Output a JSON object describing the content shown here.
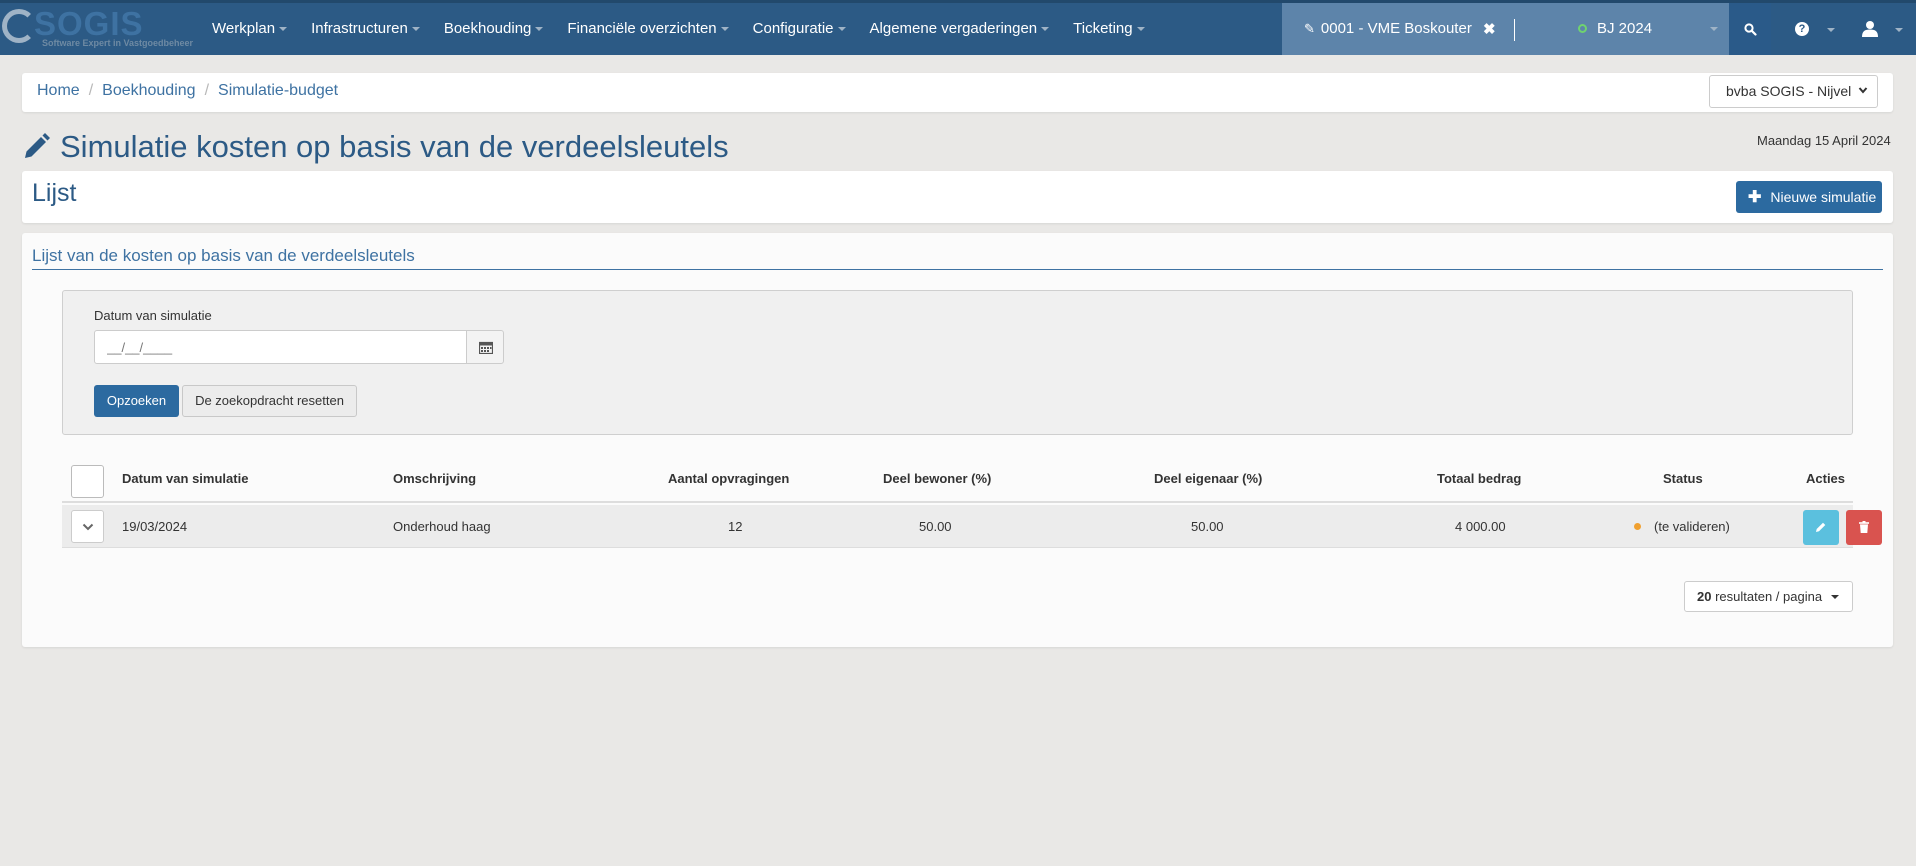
{
  "brand": {
    "name": "SOGIS",
    "tagline": "Software Expert in Vastgoedbeheer"
  },
  "nav": {
    "items": [
      {
        "label": "Werkplan"
      },
      {
        "label": "Infrastructuren"
      },
      {
        "label": "Boekhouding"
      },
      {
        "label": "Financiële overzichten"
      },
      {
        "label": "Configuratie"
      },
      {
        "label": "Algemene vergaderingen"
      },
      {
        "label": "Ticketing"
      }
    ],
    "context": {
      "building": "0001 - VME Boskouter",
      "fiscal_year": "BJ 2024"
    },
    "icons": {
      "search": "search-icon",
      "help": "help-icon",
      "user": "user-icon"
    }
  },
  "breadcrumb": {
    "items": [
      "Home",
      "Boekhouding",
      "Simulatie-budget"
    ]
  },
  "company_select": {
    "value": "bvba SOGIS - Nijvel"
  },
  "page": {
    "title": "Simulatie kosten op basis van de verdeelsleutels",
    "date": "Maandag 15 April 2024"
  },
  "list_panel": {
    "title": "Lijst",
    "new_button": "Nieuwe simulatie"
  },
  "main": {
    "heading": "Lijst van de kosten op basis van de verdeelsleutels",
    "filter": {
      "label": "Datum van simulatie",
      "placeholder": "__/__/____",
      "search_button": "Opzoeken",
      "reset_button": "De zoekopdracht resetten"
    },
    "table": {
      "columns": [
        "Datum van simulatie",
        "Omschrijving",
        "Aantal opvragingen",
        "Deel bewoner (%)",
        "Deel eigenaar (%)",
        "Totaal bedrag",
        "Status",
        "Acties"
      ],
      "rows": [
        {
          "date": "19/03/2024",
          "description": "Onderhoud haag",
          "requests": "12",
          "resident_share": "50.00",
          "owner_share": "50.00",
          "total": "4 000.00",
          "status": "(te valideren)"
        }
      ]
    },
    "pager": {
      "count": "20",
      "label": "resultaten / pagina"
    }
  },
  "colors": {
    "navbar": "#2c5a85",
    "accent": "#2c6aa0",
    "edit": "#5bc0de",
    "delete": "#d9534f",
    "status_pending": "#f0a030"
  }
}
